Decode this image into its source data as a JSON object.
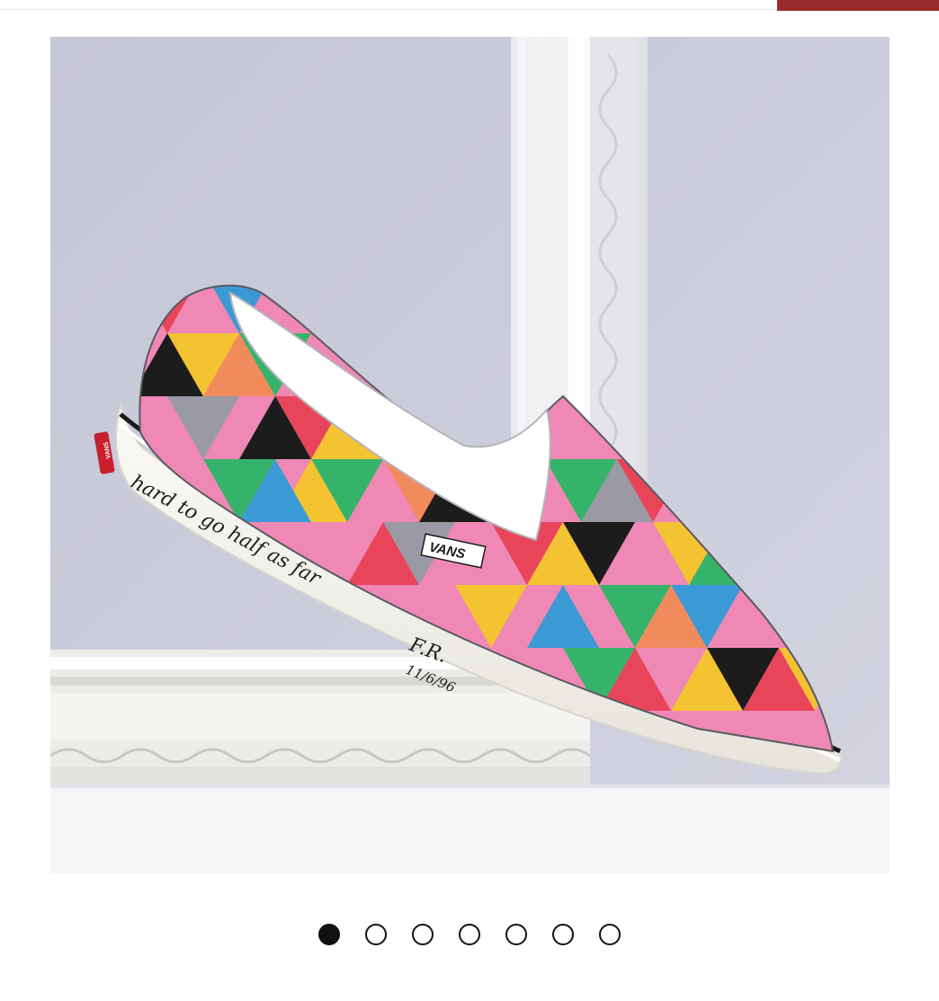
{
  "header": {
    "accent_color": "#9b2a2a"
  },
  "gallery": {
    "active_index": 0,
    "slides": [
      {
        "alt": "product-image-1"
      },
      {
        "alt": "product-image-2"
      },
      {
        "alt": "product-image-3"
      },
      {
        "alt": "product-image-4"
      },
      {
        "alt": "product-image-5"
      },
      {
        "alt": "product-image-6"
      },
      {
        "alt": "product-image-7"
      }
    ],
    "shoe": {
      "brand_tag": "VANS",
      "heel_tab": "VANS",
      "sidewall_script": "hard to go half as far",
      "signature": "F.R.",
      "date": "11/6/96"
    }
  },
  "colors": {
    "background": "#c9cbd8",
    "shoe_palette": [
      "#e8455a",
      "#f3c332",
      "#3b9ad6",
      "#1c1c1c",
      "#ef88b4",
      "#36b36a",
      "#f28b5c",
      "#9a9aa5",
      "#f6a3c4"
    ]
  }
}
